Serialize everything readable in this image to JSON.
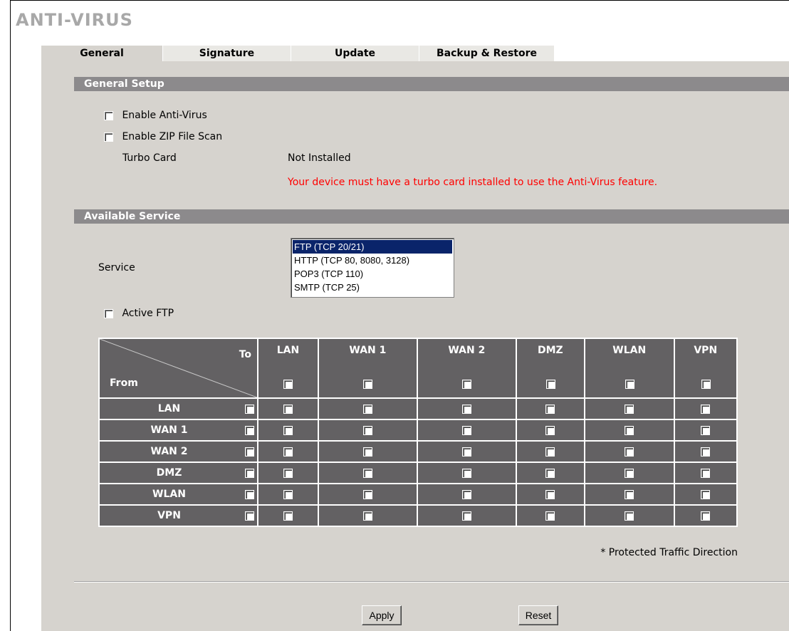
{
  "page_title": "ANTI-VIRUS",
  "tabs": [
    {
      "label": "General",
      "active": true
    },
    {
      "label": "Signature",
      "active": false
    },
    {
      "label": "Update",
      "active": false
    },
    {
      "label": "Backup & Restore",
      "active": false
    }
  ],
  "general_setup": {
    "title": "General Setup",
    "enable_antivirus_label": "Enable Anti-Virus",
    "enable_zip_label": "Enable ZIP File Scan",
    "turbo_card_label": "Turbo Card",
    "turbo_card_value": "Not Installed",
    "warning": "Your device must have a turbo card installed to use the Anti-Virus feature."
  },
  "available_service": {
    "title": "Available Service",
    "service_label": "Service",
    "options": [
      "FTP (TCP 20/21)",
      "HTTP (TCP 80, 8080, 3128)",
      "POP3 (TCP 110)",
      "SMTP (TCP 25)"
    ],
    "selected": "FTP (TCP 20/21)",
    "active_ftp_label": "Active FTP"
  },
  "matrix": {
    "to_label": "To",
    "from_label": "From",
    "columns": [
      "LAN",
      "WAN 1",
      "WAN 2",
      "DMZ",
      "WLAN",
      "VPN"
    ],
    "rows": [
      "LAN",
      "WAN 1",
      "WAN 2",
      "DMZ",
      "WLAN",
      "VPN"
    ],
    "note": "* Protected Traffic Direction"
  },
  "buttons": {
    "apply": "Apply",
    "reset": "Reset"
  },
  "colors": {
    "panel": "#d6d3ce",
    "section_bar": "#8c8a8c",
    "matrix_header": "#636163",
    "warning": "#ff0000",
    "selected_option": "#0a246a"
  }
}
